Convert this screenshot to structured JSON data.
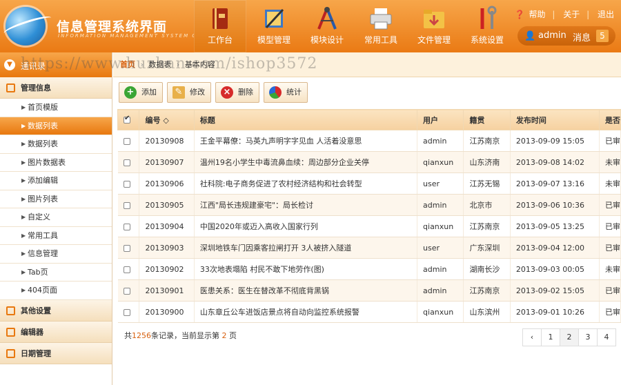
{
  "header": {
    "title": "信息管理系统界面",
    "subtitle": "INFORMATION MANAGEMENT SYSTEM GUI",
    "nav": [
      {
        "label": "工作台",
        "icon": "book-icon",
        "active": true
      },
      {
        "label": "模型管理",
        "icon": "ruler-pencil-icon",
        "active": false
      },
      {
        "label": "模块设计",
        "icon": "compass-icon",
        "active": false
      },
      {
        "label": "常用工具",
        "icon": "printer-icon",
        "active": false
      },
      {
        "label": "文件管理",
        "icon": "folder-download-icon",
        "active": false
      },
      {
        "label": "系统设置",
        "icon": "tools-icon",
        "active": false
      }
    ],
    "links": {
      "help": "帮助",
      "about": "关于",
      "logout": "退出"
    },
    "user": {
      "name": "admin",
      "messages_label": "消息",
      "messages_count": "5"
    }
  },
  "sidebar": {
    "top_label": "通讯录",
    "groups": [
      {
        "label": "管理信息",
        "icon": "list-icon"
      },
      {
        "label": "其他设置",
        "icon": "chat-icon"
      },
      {
        "label": "编辑器",
        "icon": "edit-icon"
      },
      {
        "label": "日期管理",
        "icon": "calendar-icon"
      }
    ],
    "items": [
      "首页模版",
      "数据列表",
      "数据列表",
      "图片数据表",
      "添加编辑",
      "图片列表",
      "自定义",
      "常用工具",
      "信息管理",
      "Tab页",
      "404页面"
    ],
    "active_index": 1
  },
  "breadcrumb": [
    "首页",
    "数据表",
    "基本内容"
  ],
  "toolbar": {
    "add": "添加",
    "edit": "修改",
    "delete": "删除",
    "stats": "统计"
  },
  "table": {
    "headers": [
      "编号 ◇",
      "标题",
      "用户",
      "籍贯",
      "发布时间",
      "是否"
    ],
    "rows": [
      [
        "20130908",
        "王金平幕僚：马英九声明字字见血 人活着没意思",
        "admin",
        "江苏南京",
        "2013-09-09 15:05",
        "已审"
      ],
      [
        "20130907",
        "温州19名小学生中毒流鼻血续：周边部分企业关停",
        "qianxun",
        "山东济南",
        "2013-09-08 14:02",
        "未审"
      ],
      [
        "20130906",
        "社科院:电子商务促进了农村经济结构和社会转型",
        "user",
        "江苏无锡",
        "2013-09-07 13:16",
        "未审"
      ],
      [
        "20130905",
        "江西\"局长违规建豪宅\"：局长检讨",
        "admin",
        "北京市",
        "2013-09-06 10:36",
        "已审"
      ],
      [
        "20130904",
        "中国2020年或迈入高收入国家行列",
        "qianxun",
        "江苏南京",
        "2013-09-05 13:25",
        "已审"
      ],
      [
        "20130903",
        "深圳地铁车门因乘客拉闸打开 3人被挤入隧道",
        "user",
        "广东深圳",
        "2013-09-04 12:00",
        "已审"
      ],
      [
        "20130902",
        "33次地表塌陷 村民不敢下地劳作(图)",
        "admin",
        "湖南长沙",
        "2013-09-03 00:05",
        "未审"
      ],
      [
        "20130901",
        "医患关系：医生在替改革不彻底背黑锅",
        "admin",
        "江苏南京",
        "2013-09-02 15:05",
        "已审"
      ],
      [
        "20130900",
        "山东章丘公车进饭店景点将自动向监控系统报警",
        "qianxun",
        "山东滨州",
        "2013-09-01 10:26",
        "已审"
      ]
    ]
  },
  "footer": {
    "prefix": "共",
    "total": "1256",
    "mid": "条记录，当前显示第",
    "page": "2",
    "suffix": "页"
  },
  "pagination": [
    "‹",
    "1",
    "2",
    "3",
    "4"
  ],
  "watermark": "https://www.huzhan.com/ishop3572",
  "colors": {
    "accent": "#e8780f",
    "brand_light": "#f7a64a"
  }
}
